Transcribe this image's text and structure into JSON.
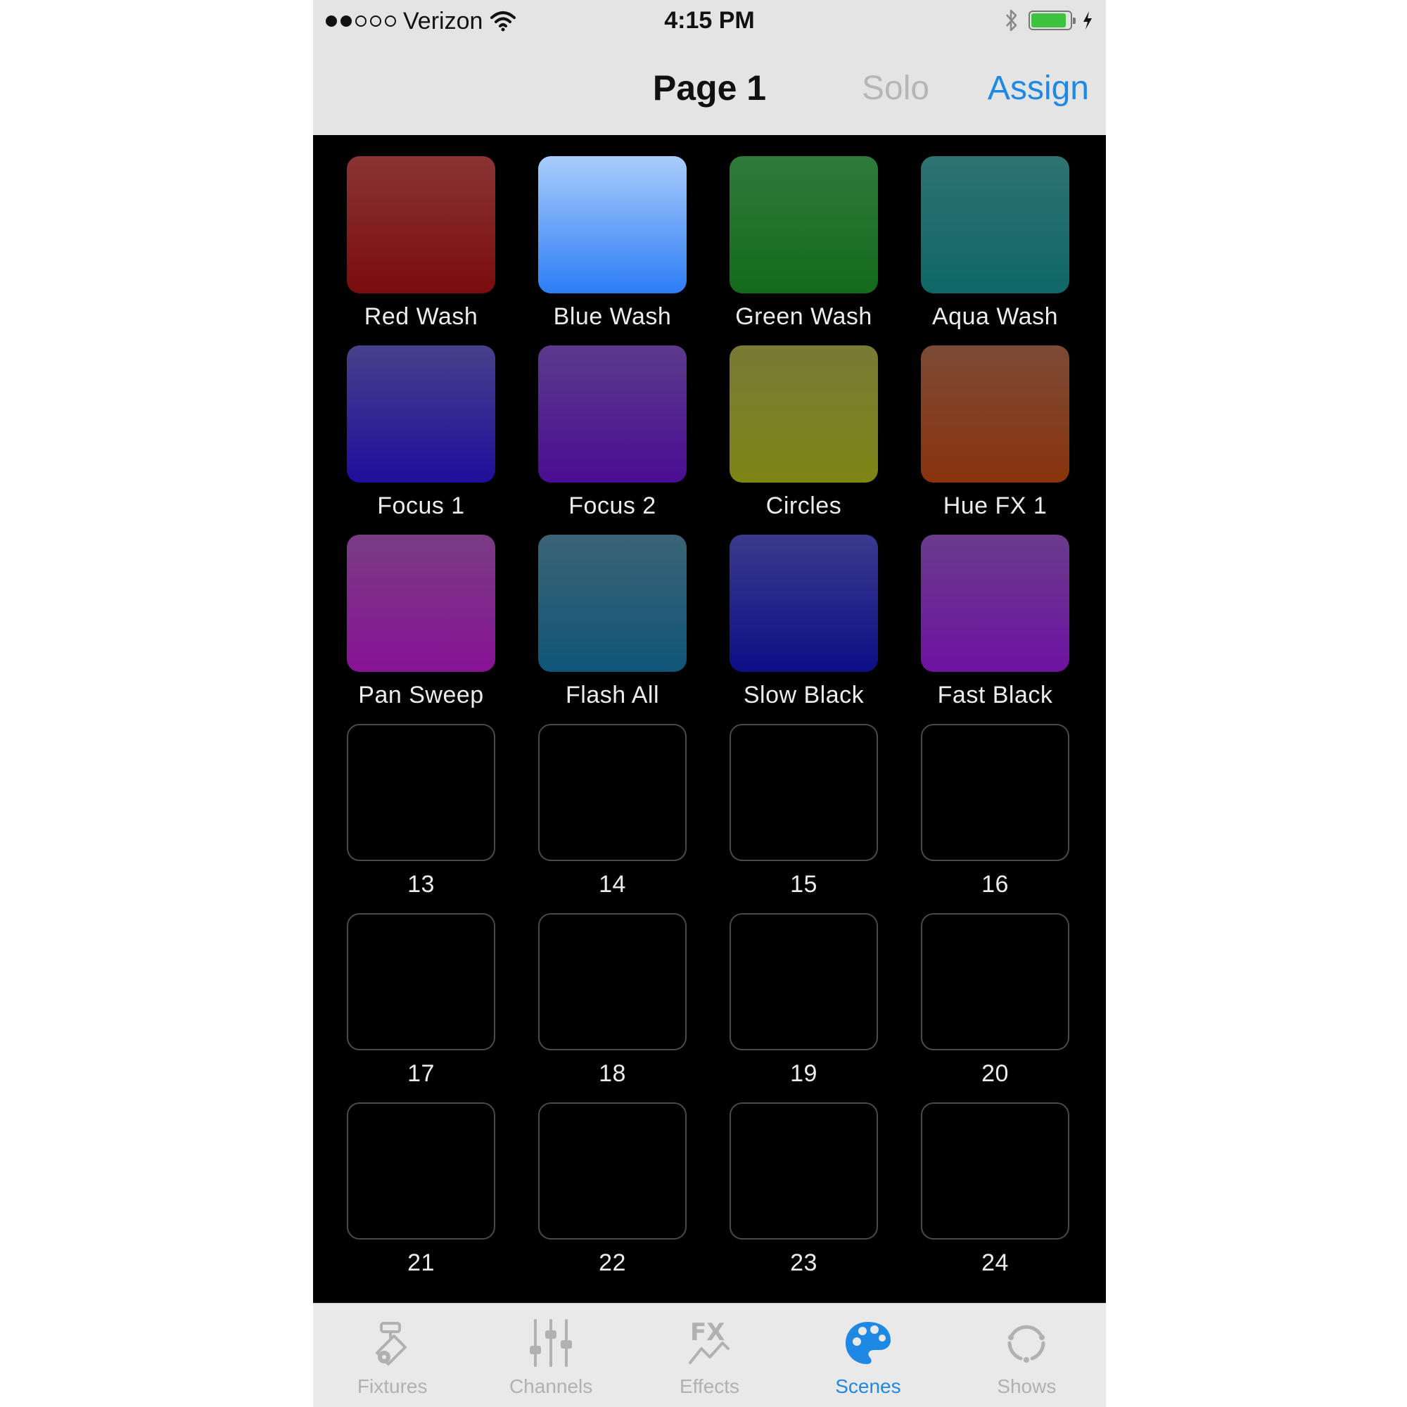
{
  "status_bar": {
    "carrier": "Verizon",
    "signal_bars": 2,
    "signal_total": 5,
    "time": "4:15 PM",
    "battery_level": 0.9
  },
  "nav": {
    "title": "Page 1",
    "solo_label": "Solo",
    "assign_label": "Assign"
  },
  "pads": [
    {
      "label": "Red Wash",
      "top": "#8a3434",
      "bottom": "#7a0c0c"
    },
    {
      "label": "Blue Wash",
      "top": "#a9cdfb",
      "bottom": "#2d7df5"
    },
    {
      "label": "Green Wash",
      "top": "#2f7a3a",
      "bottom": "#146b1c"
    },
    {
      "label": "Aqua Wash",
      "top": "#2f7272",
      "bottom": "#0f6767"
    },
    {
      "label": "Focus 1",
      "top": "#47418a",
      "bottom": "#1e0e9c"
    },
    {
      "label": "Focus 2",
      "top": "#5b3a8c",
      "bottom": "#4a0d92"
    },
    {
      "label": "Circles",
      "top": "#7a7a36",
      "bottom": "#7e8415"
    },
    {
      "label": "Hue FX 1",
      "top": "#7c4a36",
      "bottom": "#8a330c"
    },
    {
      "label": "Pan Sweep",
      "top": "#7a3c84",
      "bottom": "#871296"
    },
    {
      "label": "Flash All",
      "top": "#3b6476",
      "bottom": "#0f5578"
    },
    {
      "label": "Slow Black",
      "top": "#3b3a8c",
      "bottom": "#0c0f86"
    },
    {
      "label": "Fast Black",
      "top": "#6a3b8c",
      "bottom": "#6e12a2"
    },
    {
      "label": "13",
      "empty": true
    },
    {
      "label": "14",
      "empty": true
    },
    {
      "label": "15",
      "empty": true
    },
    {
      "label": "16",
      "empty": true
    },
    {
      "label": "17",
      "empty": true
    },
    {
      "label": "18",
      "empty": true
    },
    {
      "label": "19",
      "empty": true
    },
    {
      "label": "20",
      "empty": true
    },
    {
      "label": "21",
      "empty": true
    },
    {
      "label": "22",
      "empty": true
    },
    {
      "label": "23",
      "empty": true
    },
    {
      "label": "24",
      "empty": true
    }
  ],
  "tabs": [
    {
      "label": "Fixtures",
      "icon": "fixture-icon",
      "active": false
    },
    {
      "label": "Channels",
      "icon": "sliders-icon",
      "active": false
    },
    {
      "label": "Effects",
      "icon": "fx-icon",
      "active": false
    },
    {
      "label": "Scenes",
      "icon": "palette-icon",
      "active": true
    },
    {
      "label": "Shows",
      "icon": "loop-icon",
      "active": false
    }
  ],
  "colors": {
    "accent": "#1e88e5",
    "inactive_tab": "#b1b1b1",
    "solo_disabled": "#b6b6b6"
  }
}
